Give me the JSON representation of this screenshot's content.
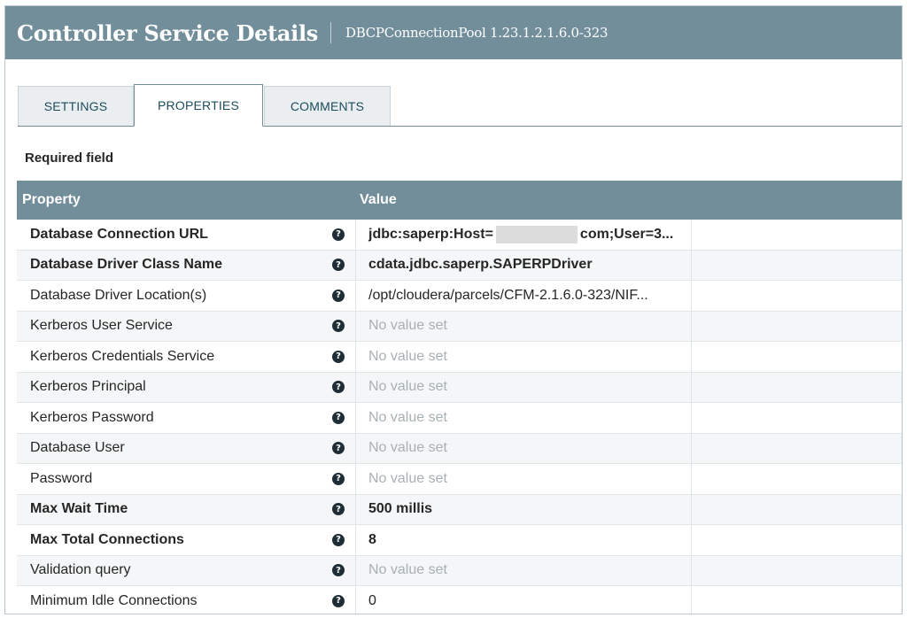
{
  "header": {
    "title": "Controller Service Details",
    "subtitle": "DBCPConnectionPool 1.23.1.2.1.6.0-323"
  },
  "tabs": [
    {
      "label": "SETTINGS",
      "active": false
    },
    {
      "label": "PROPERTIES",
      "active": true
    },
    {
      "label": "COMMENTS",
      "active": false
    }
  ],
  "required_label": "Required field",
  "table": {
    "headers": {
      "property": "Property",
      "value": "Value"
    },
    "rows": [
      {
        "name": "Database Connection URL",
        "required": true,
        "value_pre": "jdbc:saperp:Host=",
        "value_post": "com;User=3...",
        "redacted": true,
        "state": "set"
      },
      {
        "name": "Database Driver Class Name",
        "required": true,
        "value": "cdata.jdbc.saperp.SAPERPDriver",
        "state": "set"
      },
      {
        "name": "Database Driver Location(s)",
        "required": false,
        "value": "/opt/cloudera/parcels/CFM-2.1.6.0-323/NIF...",
        "state": "set"
      },
      {
        "name": "Kerberos User Service",
        "required": false,
        "value": "No value set",
        "state": "empty"
      },
      {
        "name": "Kerberos Credentials Service",
        "required": false,
        "value": "No value set",
        "state": "empty"
      },
      {
        "name": "Kerberos Principal",
        "required": false,
        "value": "No value set",
        "state": "empty"
      },
      {
        "name": "Kerberos Password",
        "required": false,
        "value": "No value set",
        "state": "empty"
      },
      {
        "name": "Database User",
        "required": false,
        "value": "No value set",
        "state": "empty"
      },
      {
        "name": "Password",
        "required": false,
        "value": "No value set",
        "state": "empty"
      },
      {
        "name": "Max Wait Time",
        "required": true,
        "value": "500 millis",
        "state": "set"
      },
      {
        "name": "Max Total Connections",
        "required": true,
        "value": "8",
        "state": "set"
      },
      {
        "name": "Validation query",
        "required": false,
        "value": "No value set",
        "state": "empty"
      },
      {
        "name": "Minimum Idle Connections",
        "required": false,
        "value": "0",
        "state": "set"
      }
    ]
  },
  "icons": {
    "help": "question-circle-icon"
  },
  "colors": {
    "header_bg": "#728e9b",
    "tab_text": "#1c4c5c",
    "empty_value": "#a8b0b4"
  }
}
